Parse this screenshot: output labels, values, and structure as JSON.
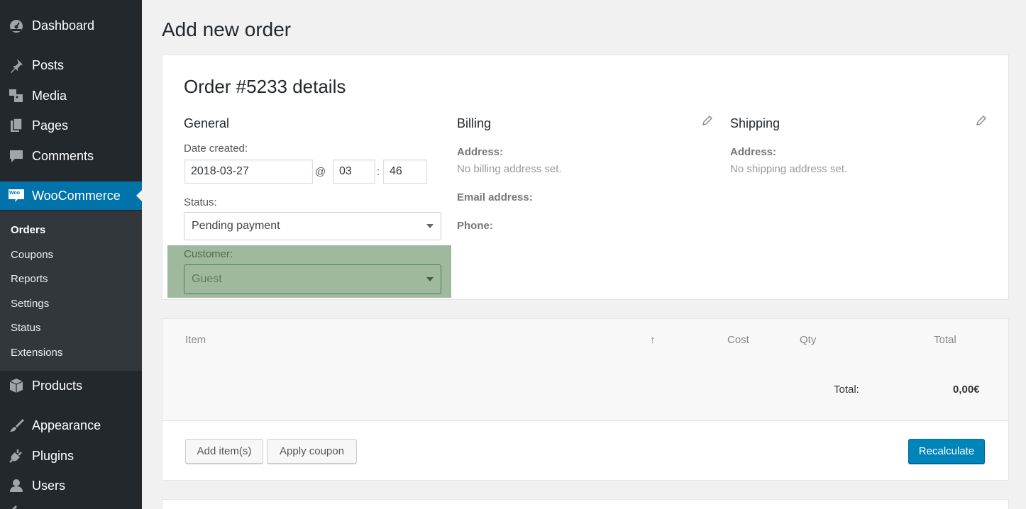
{
  "sidebar": {
    "top_items": [
      {
        "label": "Dashboard",
        "icon": "dashboard-icon"
      },
      {
        "label": "Posts",
        "icon": "pin-icon"
      },
      {
        "label": "Media",
        "icon": "media-icon"
      },
      {
        "label": "Pages",
        "icon": "pages-icon"
      },
      {
        "label": "Comments",
        "icon": "comment-icon"
      },
      {
        "label": "WooCommerce",
        "icon": "woocommerce-icon"
      }
    ],
    "woo_submenu": [
      "Orders",
      "Coupons",
      "Reports",
      "Settings",
      "Status",
      "Extensions"
    ],
    "bottom_items": [
      {
        "label": "Products",
        "icon": "box-icon"
      },
      {
        "label": "Appearance",
        "icon": "brush-icon"
      },
      {
        "label": "Plugins",
        "icon": "plug-icon"
      },
      {
        "label": "Users",
        "icon": "user-icon"
      }
    ],
    "woo_badge": "Woo"
  },
  "page": {
    "title": "Add new order"
  },
  "order": {
    "heading": "Order #5233 details",
    "general": {
      "title": "General",
      "date_label": "Date created:",
      "date_value": "2018-03-27",
      "at_sep": "@",
      "hour": "03",
      "colon_sep": ":",
      "minute": "46",
      "status_label": "Status:",
      "status_value": "Pending payment",
      "customer_label": "Customer:",
      "customer_value": "Guest"
    },
    "billing": {
      "title": "Billing",
      "address_label": "Address:",
      "address_value": "No billing address set.",
      "email_label": "Email address:",
      "phone_label": "Phone:"
    },
    "shipping": {
      "title": "Shipping",
      "address_label": "Address:",
      "address_value": "No shipping address set."
    }
  },
  "items": {
    "headers": {
      "item": "Item",
      "sort": "↑",
      "cost": "Cost",
      "qty": "Qty",
      "total": "Total"
    },
    "total_label": "Total:",
    "total_value": "0,00€",
    "add_item_button": "Add item(s)",
    "apply_coupon_button": "Apply coupon",
    "recalculate_button": "Recalculate"
  },
  "colors": {
    "sidebar_bg": "#23282d",
    "accent": "#0073aa",
    "primary_button": "#0085ba",
    "highlight": "#9fb99e"
  }
}
